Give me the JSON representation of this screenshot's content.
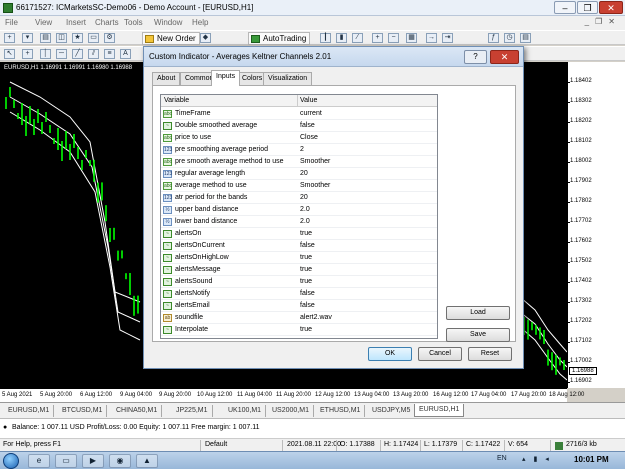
{
  "window": {
    "title": "66171527: ICMarketsSC-Demo06 - Demo Account - [EURUSD,H1]",
    "controls": [
      "–",
      "❐",
      "✕"
    ]
  },
  "menu": {
    "items": [
      "File",
      "View",
      "Insert",
      "Charts",
      "Tools",
      "Window",
      "Help"
    ],
    "mdi_controls": [
      "_",
      "❐",
      "✕"
    ]
  },
  "toolbar": {
    "new_order_label": "New Order",
    "autotrading_label": "AutoTrading"
  },
  "chart": {
    "header": "EURUSD,H1  1.16991 1.16991 1.16980 1.16988",
    "price_ticks": [
      "1.18402",
      "1.18302",
      "1.18202",
      "1.18102",
      "1.18002",
      "1.17902",
      "1.17802",
      "1.17702",
      "1.17602",
      "1.17502",
      "1.17402",
      "1.17302",
      "1.17202",
      "1.17102",
      "1.17002",
      "1.16902"
    ],
    "current_price": "1.16988",
    "time_labels": [
      "5 Aug 2021",
      "5 Aug 20:00",
      "6 Aug 12:00",
      "9 Aug 04:00",
      "9 Aug 20:00",
      "10 Aug 12:00",
      "11 Aug 04:00",
      "11 Aug 20:00",
      "12 Aug 12:00",
      "13 Aug 04:00",
      "13 Aug 20:00",
      "16 Aug 12:00",
      "17 Aug 04:00",
      "17 Aug 20:00",
      "18 Aug 12:00"
    ]
  },
  "symbol_tabs": {
    "items": [
      "EURUSD,M1",
      "BTCUSD,M1",
      "CHINA50,M1",
      "JP225,M1",
      "UK100,M1",
      "US2000,M1",
      "ETHUSD,M1",
      "USDJPY,M5",
      "EURUSD,H1"
    ],
    "active": "EURUSD,H1"
  },
  "terminal": {
    "text": "Balance: 1 007.11 USD  Profit/Loss: 0.00  Equity: 1 007.11  Free margin: 1 007.11"
  },
  "statusbar": {
    "help": "For Help, press F1",
    "profile": "Default",
    "datetime": "2021.08.11 22:00",
    "open": "O: 1.17388",
    "high": "H: 1.17424",
    "low": "L: 1.17379",
    "close": "C: 1.17422",
    "volume": "V: 654",
    "traffic": "2716/3 kb"
  },
  "taskbar": {
    "language": "EN",
    "clock": "10:01 PM"
  },
  "dialog": {
    "title": "Custom Indicator - Averages Keltner Channels 2.01",
    "help_label": "?",
    "close_label": "✕",
    "tabs": [
      "About",
      "Common",
      "Inputs",
      "Colors",
      "Visualization"
    ],
    "active_tab": "Inputs",
    "columns": {
      "variable": "Variable",
      "value": "Value"
    },
    "params": [
      {
        "type": "sel",
        "name": "TimeFrame",
        "value": "current"
      },
      {
        "type": "bool",
        "name": "Double smoothed average",
        "value": "false"
      },
      {
        "type": "sel",
        "name": "price to use",
        "value": "Close"
      },
      {
        "type": "num",
        "name": "pre smoothing average period",
        "value": "2"
      },
      {
        "type": "sel",
        "name": "pre smooth average method  to use",
        "value": "Smoother"
      },
      {
        "type": "num",
        "name": "regular average length",
        "value": "20"
      },
      {
        "type": "sel",
        "name": "average method  to use",
        "value": "Smoother"
      },
      {
        "type": "num",
        "name": "atr period for the bands",
        "value": "20"
      },
      {
        "type": "dbl",
        "name": "upper band distance",
        "value": "2.0"
      },
      {
        "type": "dbl",
        "name": "lower band distance",
        "value": "2.0"
      },
      {
        "type": "bool",
        "name": "alertsOn",
        "value": "true"
      },
      {
        "type": "bool",
        "name": "alertsOnCurrent",
        "value": "false"
      },
      {
        "type": "bool",
        "name": "alertsOnHighLow",
        "value": "true"
      },
      {
        "type": "bool",
        "name": "alertsMessage",
        "value": "true"
      },
      {
        "type": "bool",
        "name": "alertsSound",
        "value": "true"
      },
      {
        "type": "bool",
        "name": "alertsNotify",
        "value": "false"
      },
      {
        "type": "bool",
        "name": "alertsEmail",
        "value": "false"
      },
      {
        "type": "str",
        "name": "soundfile",
        "value": "alert2.wav"
      },
      {
        "type": "bool",
        "name": "Interpolate",
        "value": "true"
      }
    ],
    "type_glyphs": {
      "sel": "abc",
      "bool": "~",
      "num": "123",
      "dbl": "½",
      "str": "ab"
    },
    "load_label": "Load",
    "save_label": "Save",
    "ok_label": "OK",
    "cancel_label": "Cancel",
    "reset_label": "Reset"
  }
}
